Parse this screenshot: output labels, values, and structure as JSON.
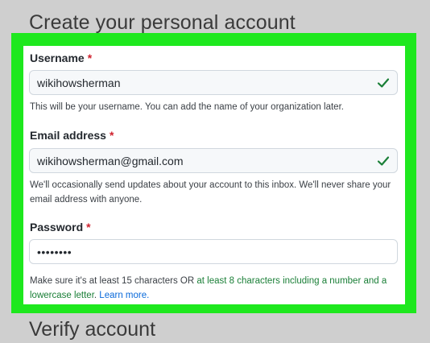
{
  "page": {
    "title": "Create your personal account",
    "next_section_title": "Verify account"
  },
  "form": {
    "username": {
      "label": "Username",
      "required_mark": "*",
      "value": "wikihowsherman",
      "hint": "This will be your username. You can add the name of your organization later."
    },
    "email": {
      "label": "Email address",
      "required_mark": "*",
      "value": "wikihowsherman@gmail.com",
      "hint": "We'll occasionally send updates about your account to this inbox. We'll never share your email address with anyone."
    },
    "password": {
      "label": "Password",
      "required_mark": "*",
      "value": "••••••••",
      "hint_prefix": "Make sure it's at least 15 characters OR ",
      "hint_green": "at least 8 characters including a number and a lowercase letter",
      "hint_suffix": ". ",
      "hint_link": "Learn more."
    }
  },
  "icons": {
    "valid": "check-icon"
  },
  "colors": {
    "highlight": "#1ee81e",
    "valid_green": "#1a7f37",
    "required_red": "#cf222e",
    "link_blue": "#0969da"
  }
}
